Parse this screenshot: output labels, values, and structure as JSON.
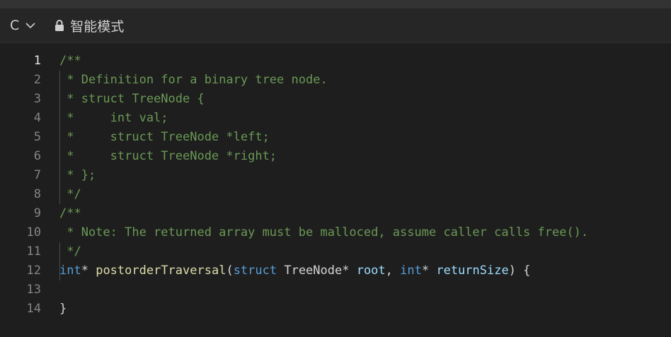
{
  "toolbar": {
    "language": "C",
    "mode_label": "智能模式"
  },
  "editor": {
    "active_line": 1,
    "lines": [
      {
        "num": "1",
        "tokens": [
          {
            "t": "/**",
            "c": "comment"
          }
        ]
      },
      {
        "num": "2",
        "tokens": [
          {
            "t": " * Definition for a binary tree node.",
            "c": "comment"
          }
        ]
      },
      {
        "num": "3",
        "tokens": [
          {
            "t": " * struct TreeNode {",
            "c": "comment"
          }
        ]
      },
      {
        "num": "4",
        "tokens": [
          {
            "t": " *     int val;",
            "c": "comment"
          }
        ]
      },
      {
        "num": "5",
        "tokens": [
          {
            "t": " *     struct TreeNode *left;",
            "c": "comment"
          }
        ]
      },
      {
        "num": "6",
        "tokens": [
          {
            "t": " *     struct TreeNode *right;",
            "c": "comment"
          }
        ]
      },
      {
        "num": "7",
        "tokens": [
          {
            "t": " * };",
            "c": "comment"
          }
        ]
      },
      {
        "num": "8",
        "tokens": [
          {
            "t": " */",
            "c": "comment"
          }
        ]
      },
      {
        "num": "9",
        "tokens": [
          {
            "t": "/**",
            "c": "comment"
          }
        ]
      },
      {
        "num": "10",
        "tokens": [
          {
            "t": " * Note: The returned array must be malloced, assume caller calls free().",
            "c": "comment"
          }
        ]
      },
      {
        "num": "11",
        "tokens": [
          {
            "t": " */",
            "c": "comment"
          }
        ]
      },
      {
        "num": "12",
        "tokens": [
          {
            "t": "int",
            "c": "kw"
          },
          {
            "t": "* ",
            "c": "punc"
          },
          {
            "t": "postorderTraversal",
            "c": "fn"
          },
          {
            "t": "(",
            "c": "punc"
          },
          {
            "t": "struct",
            "c": "kw"
          },
          {
            "t": " TreeNode* ",
            "c": "type"
          },
          {
            "t": "root",
            "c": "param"
          },
          {
            "t": ", ",
            "c": "punc"
          },
          {
            "t": "int",
            "c": "kw"
          },
          {
            "t": "* ",
            "c": "punc"
          },
          {
            "t": "returnSize",
            "c": "param"
          },
          {
            "t": ") {",
            "c": "punc"
          }
        ]
      },
      {
        "num": "13",
        "tokens": []
      },
      {
        "num": "14",
        "tokens": [
          {
            "t": "}",
            "c": "punc"
          }
        ]
      }
    ]
  }
}
